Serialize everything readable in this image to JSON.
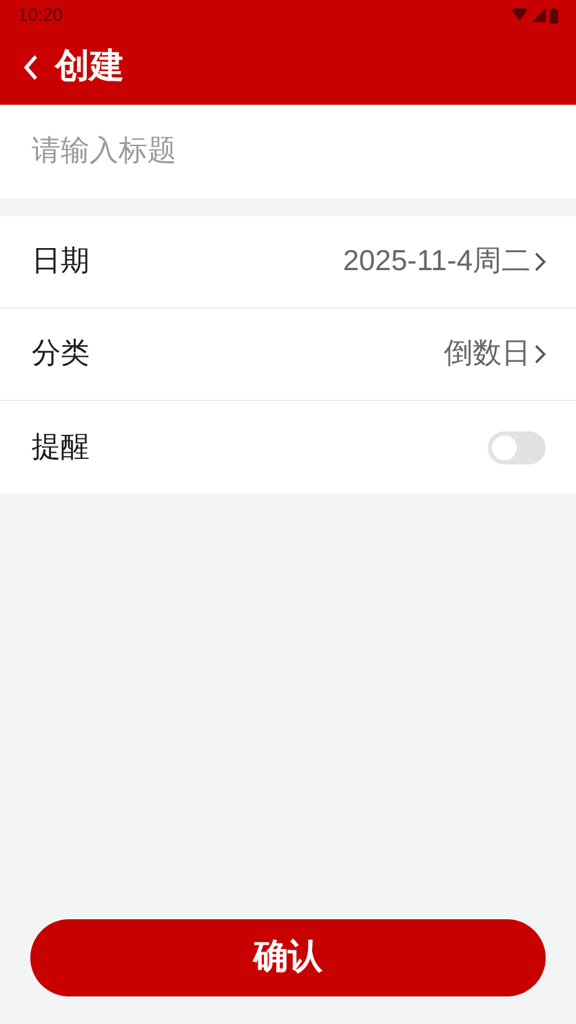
{
  "status_bar": {
    "time": "10:20"
  },
  "toolbar": {
    "title": "创建"
  },
  "title_field": {
    "placeholder": "请输入标题"
  },
  "rows": [
    {
      "kind": "value",
      "label": "日期",
      "value": "2025-11-4周二"
    },
    {
      "kind": "value",
      "label": "分类",
      "value": "倒数日"
    },
    {
      "kind": "toggle",
      "label": "提醒",
      "on": false
    }
  ],
  "confirm_button": {
    "label": "确认"
  }
}
